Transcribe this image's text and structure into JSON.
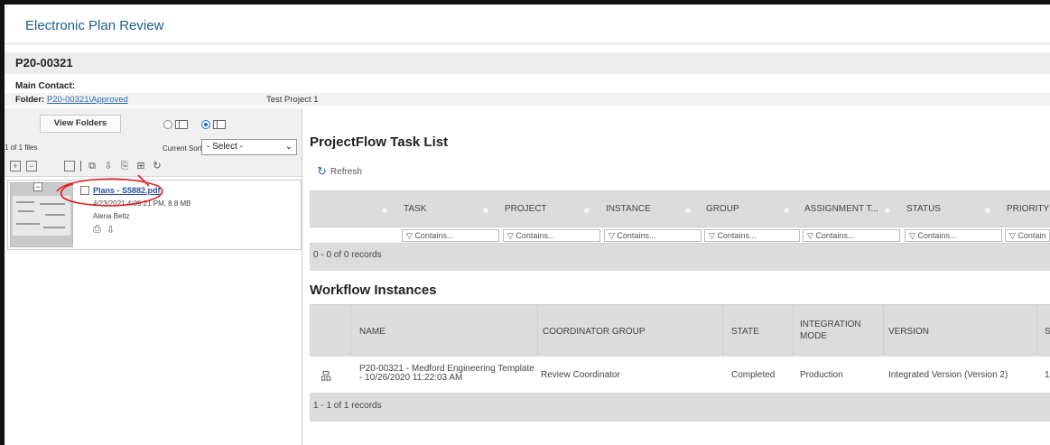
{
  "app": {
    "title": "Electronic Plan Review"
  },
  "project": {
    "id": "P20-00321",
    "main_contact_label": "Main Contact:",
    "main_contact_value": ""
  },
  "folder": {
    "label": "Folder:",
    "path": "P20-00321\\Approved",
    "project_name": "Test Project 1"
  },
  "left_panel": {
    "view_folders_label": "View Folders",
    "file_count": "1 of 1 files",
    "sort_label": "Current Sort:",
    "sort_value": "- Select -",
    "toolbar_icons": [
      "expand-all-icon",
      "collapse-all-icon",
      "select-all-icon",
      "compare-icon",
      "download-icon",
      "copy-icon",
      "merge-icon",
      "refresh-icon"
    ],
    "file": {
      "name": "Plans - S5882.pdf",
      "meta": "4/23/2021 4:09:21 PM, 8.8 MB",
      "author": "Alena Beltz"
    }
  },
  "tasks": {
    "title": "ProjectFlow Task List",
    "refresh_label": "Refresh",
    "columns": [
      "TASK",
      "PROJECT",
      "INSTANCE",
      "GROUP",
      "ASSIGNMENT T...",
      "STATUS",
      "PRIORITY"
    ],
    "filter_placeholder": "Contains...",
    "filter_truncated": "Contain",
    "records": "0 - 0 of 0 records"
  },
  "workflow": {
    "title": "Workflow Instances",
    "columns": [
      "NAME",
      "COORDINATOR GROUP",
      "STATE",
      "INTEGRATION MODE",
      "VERSION",
      "S"
    ],
    "integration_mode_line1": "INTEGRATION",
    "integration_mode_line2": "MODE",
    "row": {
      "name_line1": "P20-00321 - Medford Engineering Template",
      "name_line2": "- 10/26/2020 11:22:03 AM",
      "coordinator_group": "Review Coordinator",
      "state": "Completed",
      "integration_mode": "Production",
      "version": "Integrated Version (Version 2)",
      "s": "1"
    },
    "records": "1 - 1 of 1 records"
  },
  "colors": {
    "link": "#2a6ab0",
    "title_blue": "#1a5e8e",
    "grid_header": "#dcdcdc",
    "annotation": "#e02020"
  }
}
